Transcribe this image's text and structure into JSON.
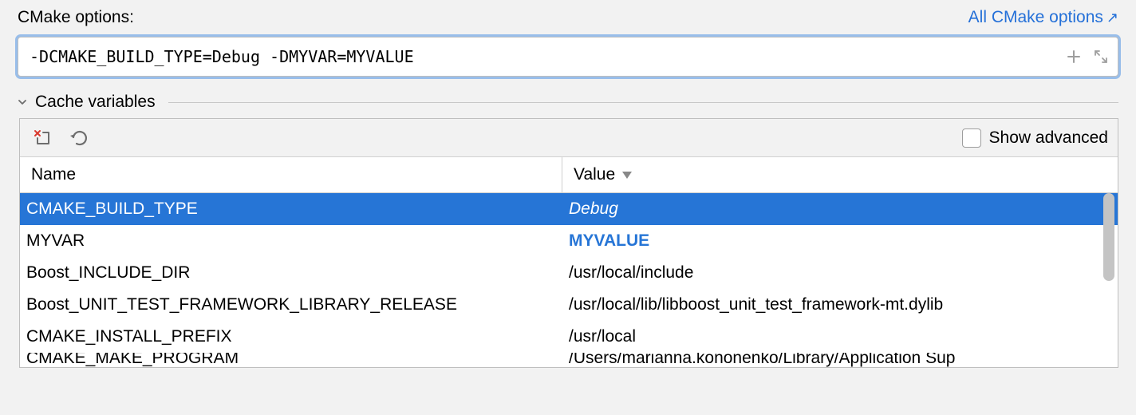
{
  "header": {
    "options_label": "CMake options:",
    "all_options_link": "All CMake options"
  },
  "options_input": {
    "value": "-DCMAKE_BUILD_TYPE=Debug -DMYVAR=MYVALUE"
  },
  "cache_section": {
    "title": "Cache variables",
    "show_advanced_label": "Show advanced",
    "columns": {
      "name": "Name",
      "value": "Value"
    },
    "rows": [
      {
        "name": "CMAKE_BUILD_TYPE",
        "value": "Debug",
        "selected": true,
        "style": "italic"
      },
      {
        "name": "MYVAR",
        "value": "MYVALUE",
        "selected": false,
        "style": "bold-blue"
      },
      {
        "name": "Boost_INCLUDE_DIR",
        "value": "/usr/local/include",
        "selected": false,
        "style": "normal"
      },
      {
        "name": "Boost_UNIT_TEST_FRAMEWORK_LIBRARY_RELEASE",
        "value": "/usr/local/lib/libboost_unit_test_framework-mt.dylib",
        "selected": false,
        "style": "normal"
      },
      {
        "name": "CMAKE_INSTALL_PREFIX",
        "value": "/usr/local",
        "selected": false,
        "style": "normal"
      },
      {
        "name": "CMAKE_MAKE_PROGRAM",
        "value": "/Users/marianna.kononenko/Library/Application Sup",
        "selected": false,
        "style": "normal"
      }
    ]
  }
}
